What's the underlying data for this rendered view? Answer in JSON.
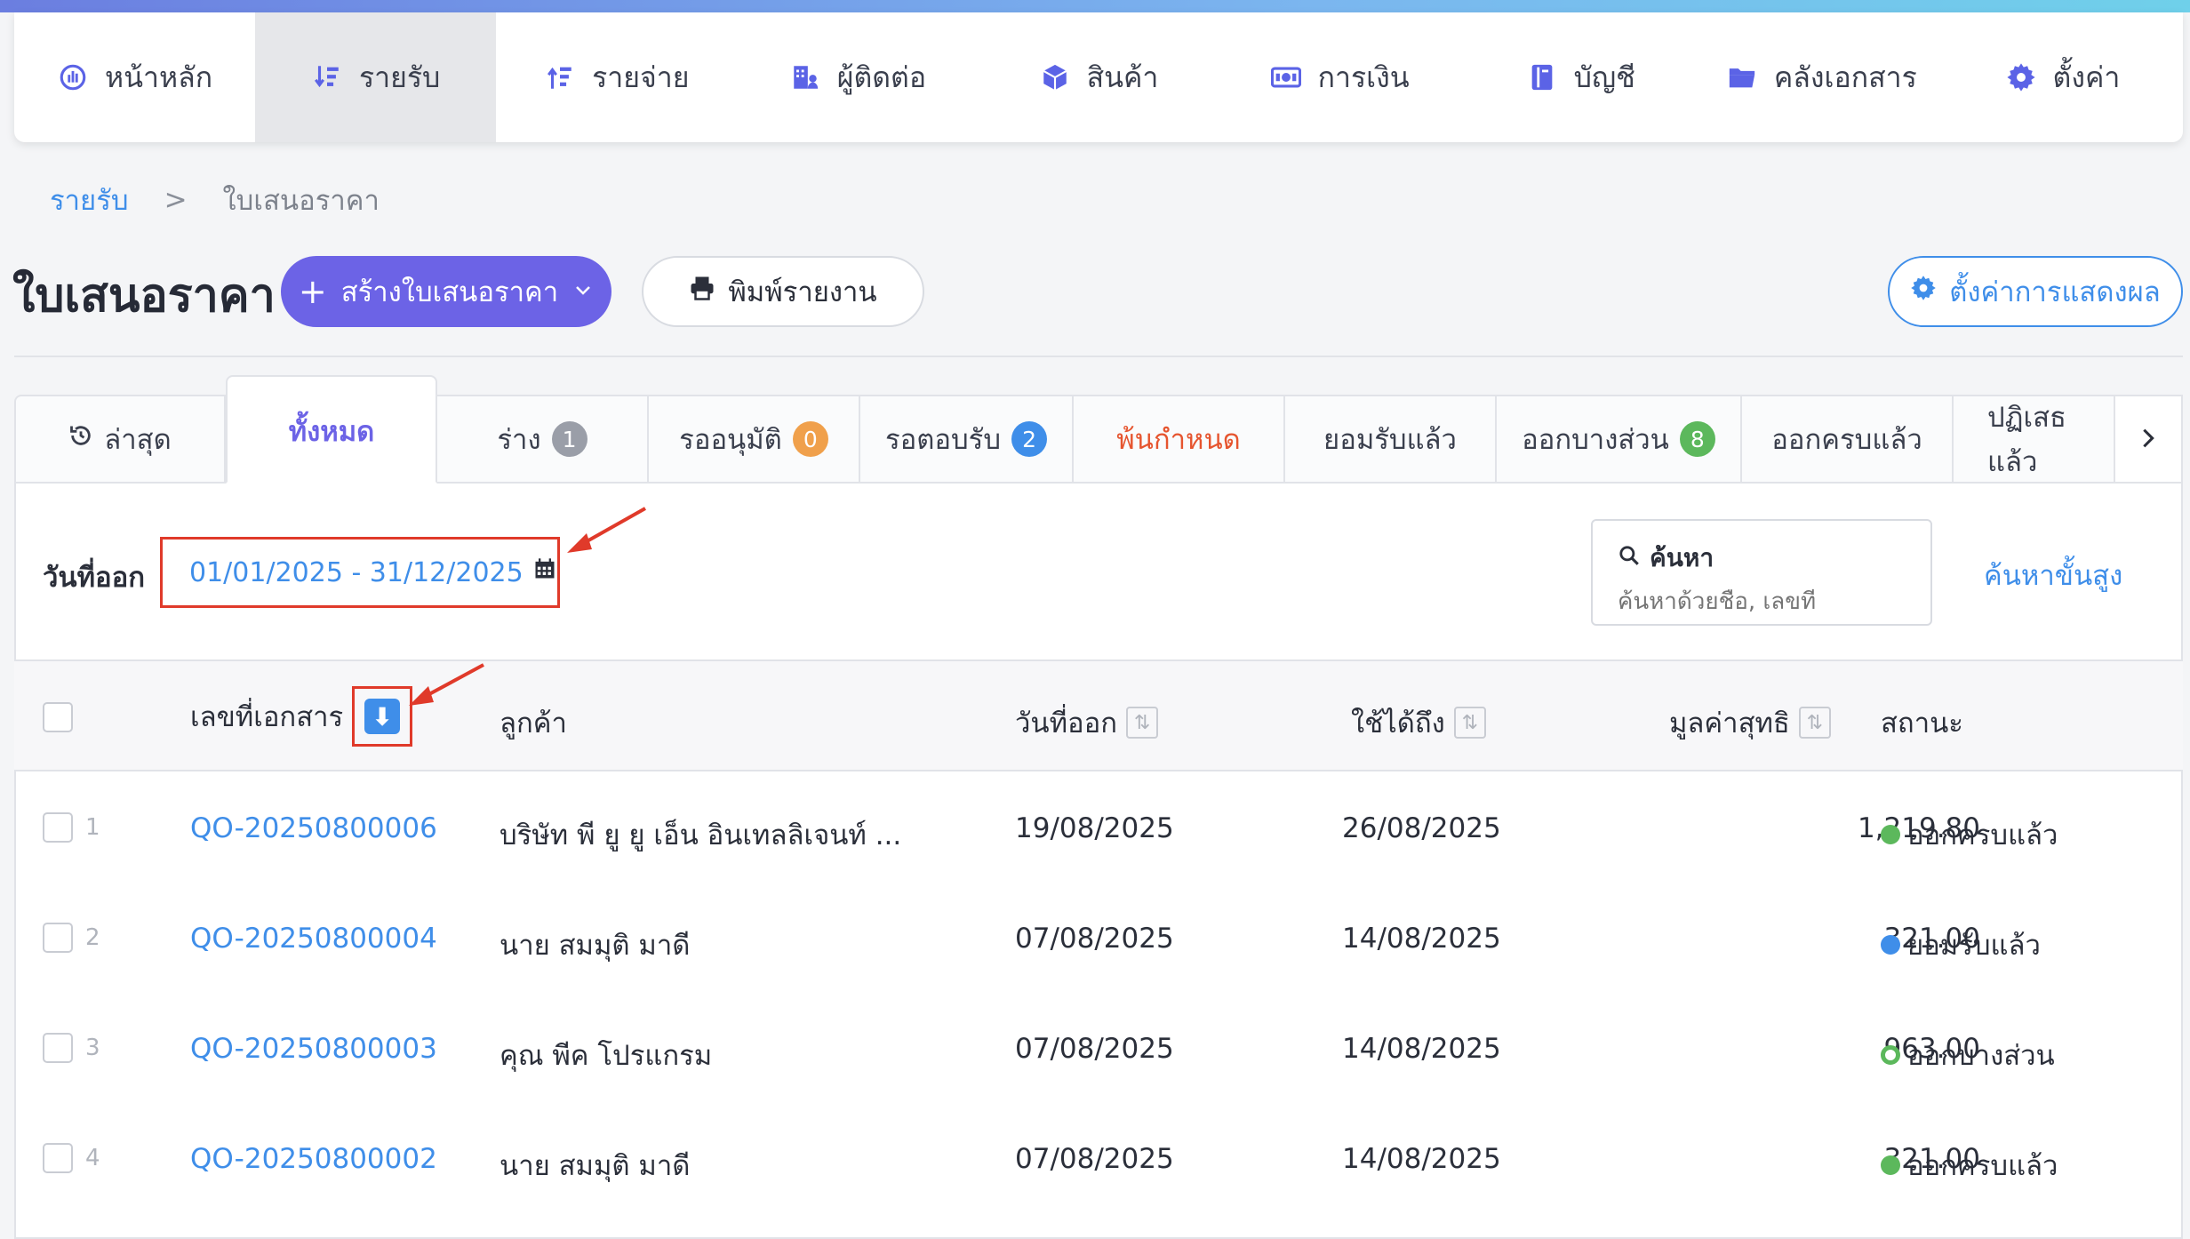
{
  "nav": {
    "items": [
      {
        "label": "หน้าหลัก",
        "icon": "dashboard-icon"
      },
      {
        "label": "รายรับ",
        "icon": "income-sort-icon",
        "active": true
      },
      {
        "label": "รายจ่าย",
        "icon": "expense-sort-icon"
      },
      {
        "label": "ผู้ติดต่อ",
        "icon": "contacts-building-icon"
      },
      {
        "label": "สินค้า",
        "icon": "product-box-icon"
      },
      {
        "label": "การเงิน",
        "icon": "money-icon"
      },
      {
        "label": "บัญชี",
        "icon": "ledger-book-icon"
      },
      {
        "label": "คลังเอกสาร",
        "icon": "folder-icon"
      },
      {
        "label": "ตั้งค่า",
        "icon": "gear-icon"
      }
    ]
  },
  "breadcrumb": {
    "parent": "รายรับ",
    "separator": ">",
    "current": "ใบเสนอราคา"
  },
  "page": {
    "title": "ใบเสนอราคา",
    "create_label": "สร้างใบเสนอราคา",
    "print_label": "พิมพ์รายงาน",
    "display_settings_label": "ตั้งค่าการแสดงผล"
  },
  "tabs": [
    {
      "label": "ล่าสุด",
      "icon": "history-icon"
    },
    {
      "label": "ทั้งหมด",
      "active": true
    },
    {
      "label": "ร่าง",
      "badge": "1",
      "badge_color": "#9a9ea8"
    },
    {
      "label": "รออนุมัติ",
      "badge": "0",
      "badge_color": "#f0a04b"
    },
    {
      "label": "รอตอบรับ",
      "badge": "2",
      "badge_color": "#3f8ee9"
    },
    {
      "label": "พ้นกำหนด",
      "color": "#e6552f"
    },
    {
      "label": "ยอมรับแล้ว"
    },
    {
      "label": "ออกบางส่วน",
      "badge": "8",
      "badge_color": "#5cb85c"
    },
    {
      "label": "ออกครบแล้ว"
    },
    {
      "label": "ปฏิเสธแล้ว"
    }
  ],
  "filters": {
    "date_label": "วันที่ออก",
    "date_range": "01/01/2025 - 31/12/2025",
    "search_title": "ค้นหา",
    "search_placeholder": "ค้นหาด้วยชื่อ, เลขที่",
    "advanced_search": "ค้นหาขั้นสูง"
  },
  "table": {
    "columns": {
      "doc_no": "เลขที่เอกสาร",
      "customer": "ลูกค้า",
      "issue_date": "วันที่ออก",
      "valid_until": "ใช้ได้ถึง",
      "net_value": "มูลค่าสุทธิ",
      "status": "สถานะ"
    },
    "rows": [
      {
        "num": "1",
        "doc_no": "QO-20250800006",
        "customer": "บริษัท พี ยู ยู เอ็น อินเทลลิเจนท์ ...",
        "issue_date": "19/08/2025",
        "valid_until": "26/08/2025",
        "net_value": "1,219.80",
        "status": "ออกครบแล้ว",
        "status_color": "#5cb85c",
        "status_style": "solid"
      },
      {
        "num": "2",
        "doc_no": "QO-20250800004",
        "customer": "นาย สมมุติ มาดี",
        "issue_date": "07/08/2025",
        "valid_until": "14/08/2025",
        "net_value": "321.00",
        "status": "ยอมรับแล้ว",
        "status_color": "#3f8ee9",
        "status_style": "solid"
      },
      {
        "num": "3",
        "doc_no": "QO-20250800003",
        "customer": "คุณ พีค โปรแกรม",
        "issue_date": "07/08/2025",
        "valid_until": "14/08/2025",
        "net_value": "963.00",
        "status": "ออกบางส่วน",
        "status_color": "#5cb85c",
        "status_style": "ring"
      },
      {
        "num": "4",
        "doc_no": "QO-20250800002",
        "customer": "นาย สมมุติ มาดี",
        "issue_date": "07/08/2025",
        "valid_until": "14/08/2025",
        "net_value": "321.00",
        "status": "ออกครบแล้ว",
        "status_color": "#5cb85c",
        "status_style": "solid"
      }
    ]
  },
  "colors": {
    "accent": "#6c63e6",
    "link": "#3f8ee9",
    "annotation": "#e03a2a"
  }
}
